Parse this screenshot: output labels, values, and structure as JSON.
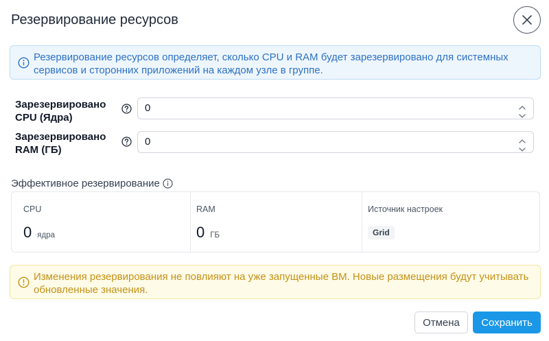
{
  "dialog": {
    "title": "Резервирование ресурсов",
    "info_text": "Резервирование ресурсов определяет, сколько CPU и RAM будет зарезервировано для системных сервисов и сторонних приложений на каждом узле в группе."
  },
  "form": {
    "cpu": {
      "label_line1": "Зарезервировано",
      "label_line2": "CPU (Ядра)",
      "value": "0"
    },
    "ram": {
      "label_line1": "Зарезервировано",
      "label_line2": "RAM (ГБ)",
      "value": "0"
    }
  },
  "effective": {
    "section_label": "Эффективное резервирование",
    "cpu": {
      "label": "CPU",
      "value": "0",
      "unit": "ядра"
    },
    "ram": {
      "label": "RAM",
      "value": "0",
      "unit": "ГБ"
    },
    "source": {
      "label": "Источник настроек",
      "badge": "Grid"
    }
  },
  "warning": {
    "text": "Изменения резервирования не повлияют на уже запущенные ВМ. Новые размещения будут учитывать обновленные значения."
  },
  "footer": {
    "cancel_label": "Отмена",
    "save_label": "Сохранить"
  },
  "colors": {
    "info_text": "#2d72c4",
    "info_bg": "#eef6fd",
    "warn_text": "#c49216",
    "warn_bg": "#fefbe8",
    "primary": "#1a97e6"
  }
}
